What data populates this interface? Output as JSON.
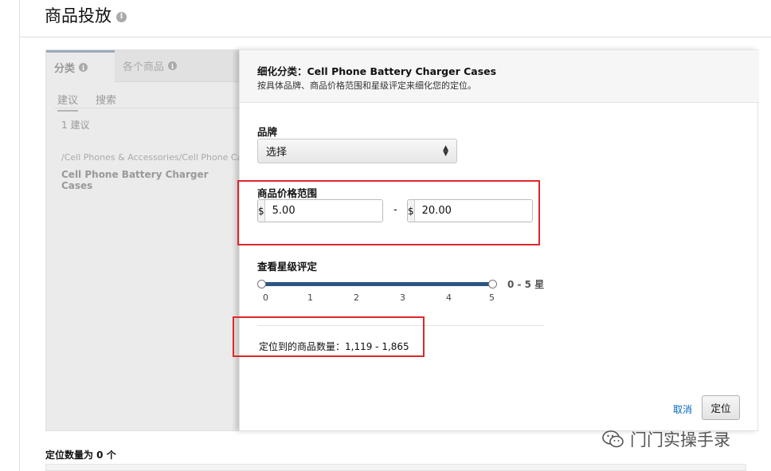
{
  "page": {
    "title": "商品投放"
  },
  "left_panel": {
    "tabs": [
      "分类",
      "各个商品"
    ],
    "subtabs": [
      "建议",
      "搜索"
    ],
    "suggestion_count": "1 建议",
    "category_path": "/Cell Phones & Accessories/Cell Phone Cases",
    "category_name": "Cell Phone Battery Charger Cases"
  },
  "refine": {
    "title": "细化分类：Cell Phone Battery Charger Cases",
    "subtitle": "按具体品牌、商品价格范围和星级评定来细化您的定位。",
    "brand_label": "品牌",
    "brand_select": "选择",
    "price_label": "商品价格范围",
    "currency": "$",
    "price_min": "5.00",
    "price_max": "20.00",
    "price_separator": "-",
    "rating_label": "查看星级评定",
    "rating_range_text": "0 - 5 星",
    "rating_min": 0,
    "rating_max": 5,
    "ticks": [
      "0",
      "1",
      "2",
      "3",
      "4",
      "5"
    ],
    "product_count": "定位到的商品数量：1,119 - 1,865",
    "cancel": "取消",
    "confirm": "定位"
  },
  "footer": {
    "target_count": "定位数量为 0 个"
  },
  "watermark": {
    "text": "门门实操手录"
  },
  "colors": {
    "highlight": "#e0262a",
    "slider": "#2c5581",
    "link": "#0066c0"
  }
}
